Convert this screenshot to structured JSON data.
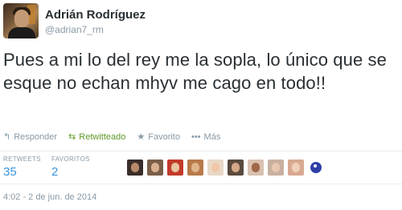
{
  "user": {
    "full_name": "Adrián Rodríguez",
    "handle": "@adrian7_rm"
  },
  "tweet": {
    "text": "Pues a mi lo del rey me la sopla, lo único que se esque no echan mhyv me cago en todo!!",
    "timestamp": "4:02 - 2 de jun. de 2014"
  },
  "actions": {
    "reply_label": "Responder",
    "reply_icon": "reply-icon",
    "retweet_label": "Retwitteado",
    "retweet_icon": "retweet-icon",
    "retweet_color": "#609928",
    "favorite_label": "Favorito",
    "favorite_icon": "star-icon",
    "more_label": "Más",
    "more_icon": "ellipsis-icon"
  },
  "stats": {
    "retweets_label": "RETWEETS",
    "retweets_count": "35",
    "favorites_label": "FAVORITOS",
    "favorites_count": "2"
  },
  "colors": {
    "link_blue": "#3b94d9",
    "muted_gray": "#8899a6",
    "text_dark": "#292f33"
  }
}
